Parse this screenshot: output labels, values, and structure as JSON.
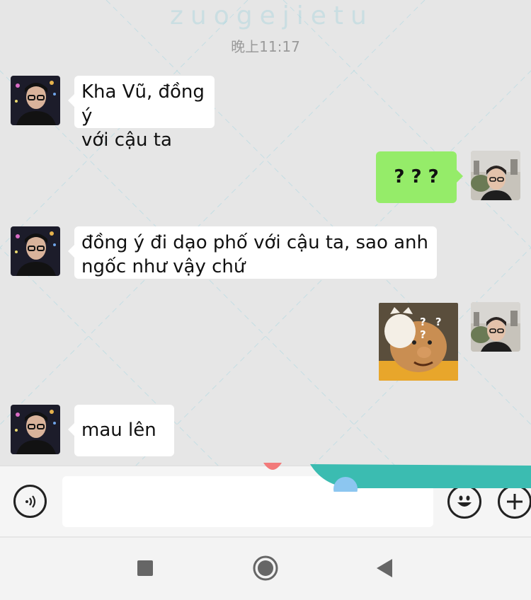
{
  "watermark": "zuogejietu",
  "timestamp": "晚上11:17",
  "messages": [
    {
      "side": "left",
      "type": "text",
      "text": [
        "Kha Vũ, đồng ý",
        "với cậu ta"
      ]
    },
    {
      "side": "right",
      "type": "text",
      "text": "? ? ?"
    },
    {
      "side": "left",
      "type": "text",
      "text": [
        "đồng ý đi dạo phố với cậu ta, sao anh",
        "ngốc như vậy chứ"
      ]
    },
    {
      "side": "right",
      "type": "sticker",
      "caption": "? ? ?"
    },
    {
      "side": "left",
      "type": "text",
      "text": "mau lên !"
    }
  ],
  "input_bar": {
    "voice_icon": "voice-wave-icon",
    "emoji_icon": "smiley-face-icon",
    "plus_icon": "plus-icon"
  },
  "nav_bar": {
    "recent_icon": "square-icon",
    "home_icon": "circle-home-icon",
    "back_icon": "triangle-back-icon"
  },
  "colors": {
    "background": "#e6e6e6",
    "own_bubble": "#95ec69",
    "other_bubble": "#ffffff",
    "timestamp": "#9a9a9a"
  }
}
